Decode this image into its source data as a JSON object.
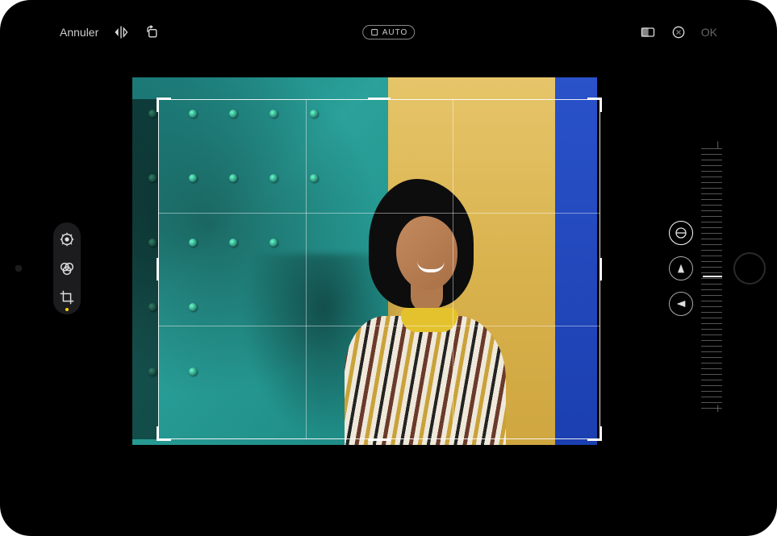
{
  "topbar": {
    "cancel_label": "Annuler",
    "auto_label": "AUTO",
    "ok_label": "OK"
  },
  "left_rail": {
    "adjust_name": "adjust",
    "filters_name": "filters",
    "crop_name": "crop"
  },
  "right_rail": {
    "straighten_name": "straighten",
    "vertical_name": "vertical-perspective",
    "horizontal_name": "horizontal-perspective"
  },
  "ruler": {
    "top_mark": "|",
    "bottom_mark": "|"
  }
}
